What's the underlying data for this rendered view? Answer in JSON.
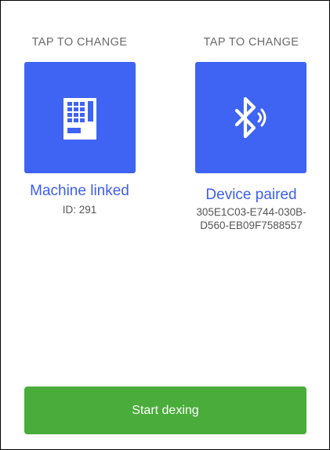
{
  "machine": {
    "caption": "TAP TO CHANGE",
    "icon": "vending-machine-icon",
    "status": "Machine linked",
    "id_label": "ID: 291"
  },
  "device": {
    "caption": "TAP TO CHANGE",
    "icon": "bluetooth-icon",
    "status": "Device paired",
    "uuid_line1": "305E1C03-E744-030B-",
    "uuid_line2": "D560-EB09F7588557"
  },
  "action": {
    "start_label": "Start dexing"
  },
  "colors": {
    "tile": "#3f63f2",
    "status_text": "#3d5ef0",
    "button": "#4aac3a"
  }
}
